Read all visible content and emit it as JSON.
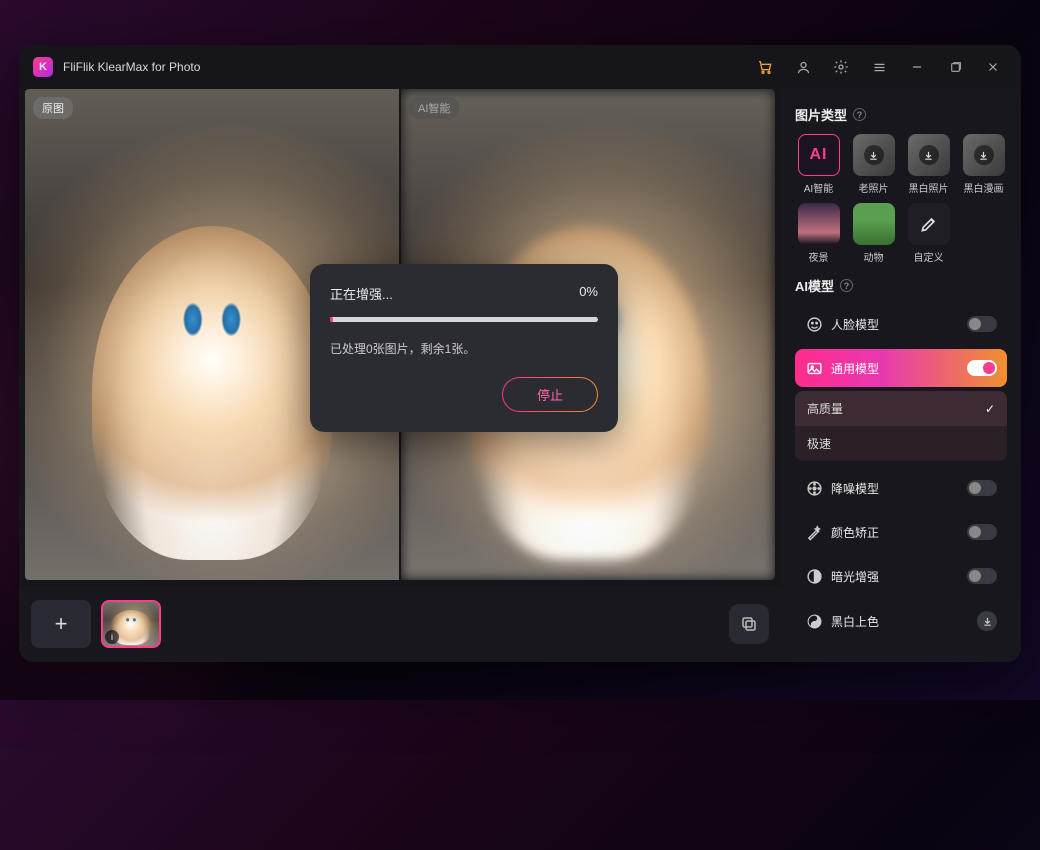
{
  "titlebar": {
    "app_name": "FliFlik KlearMax for Photo",
    "logo_letter": "K"
  },
  "preview": {
    "original_badge": "原图",
    "enhanced_badge": "AI智能"
  },
  "modal": {
    "title": "正在增强...",
    "percent": "0%",
    "status": "已处理0张图片，剩余1张。",
    "stop": "停止"
  },
  "sidebar": {
    "section_image_type": "图片类型",
    "types": {
      "ai": "AI智能",
      "old": "老照片",
      "bw_photo": "黑白照片",
      "bw_comic": "黑白漫画",
      "night": "夜景",
      "animal": "动物",
      "custom": "自定义"
    },
    "section_ai_model": "AI模型",
    "models": {
      "face": "人脸模型",
      "general": "通用模型",
      "denoise": "降噪模型",
      "color_fix": "颜色矫正",
      "lowlight": "暗光增强",
      "bw_color": "黑白上色"
    },
    "general_options": {
      "high_quality": "高质量",
      "fast": "极速"
    }
  },
  "colors": {
    "accent_pink": "#ff3b8d",
    "accent_orange": "#f09030"
  }
}
